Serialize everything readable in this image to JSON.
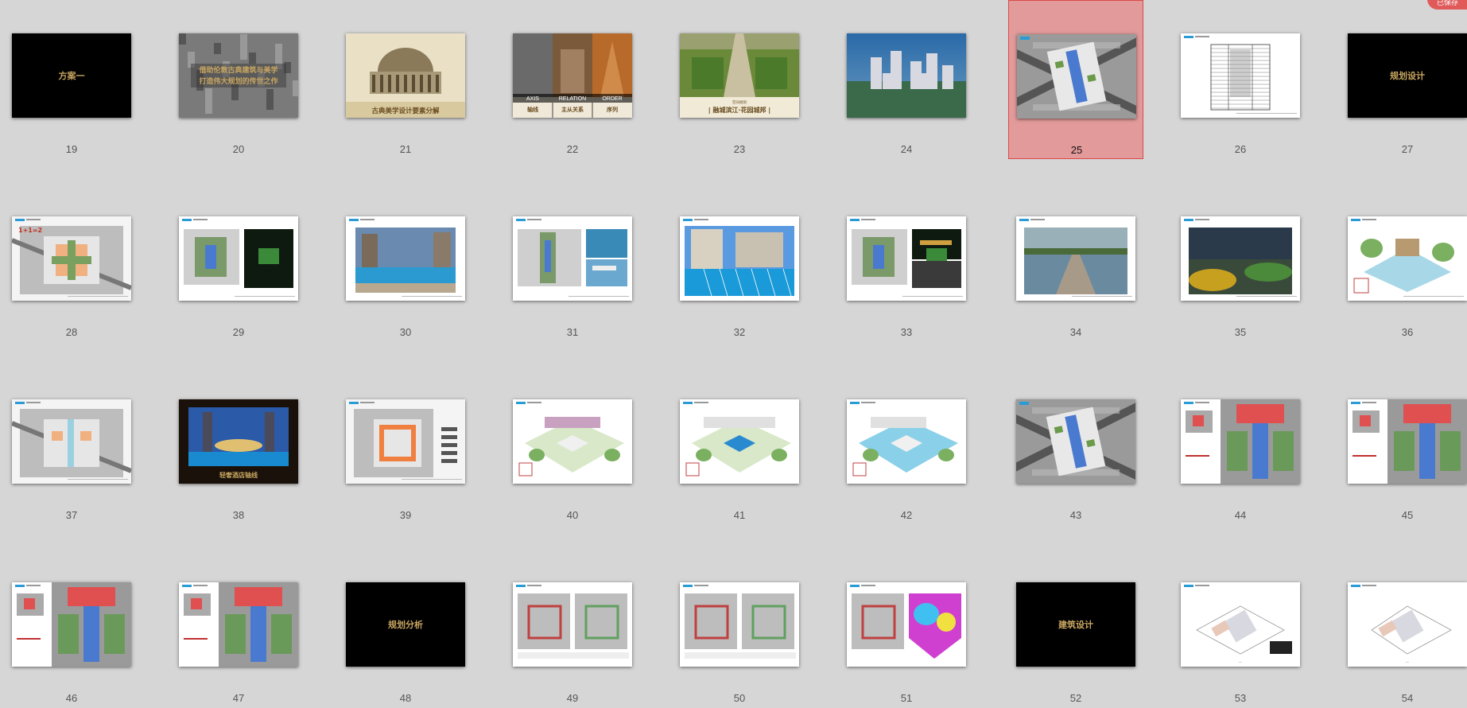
{
  "slides": [
    {
      "num": "19",
      "type": "title-dark",
      "text": "方案一"
    },
    {
      "num": "20",
      "type": "aerial-gray-title",
      "lines": [
        "借助伦敦古典建筑与美学",
        "打造伟大规划的传世之作"
      ]
    },
    {
      "num": "21",
      "type": "pantheon",
      "text": "古典美学设计要素分解"
    },
    {
      "num": "22",
      "type": "triptych",
      "labels_en": [
        "AXIS",
        "RELATION",
        "ORDER"
      ],
      "labels_cn": [
        "轴线",
        "主从关系",
        "序列"
      ]
    },
    {
      "num": "23",
      "type": "garden",
      "subtitle": "空间规划",
      "text": "| 融城滨江·花园城邦 |"
    },
    {
      "num": "24",
      "type": "rendering"
    },
    {
      "num": "25",
      "type": "siteplan",
      "selected": true
    },
    {
      "num": "26",
      "type": "table-doc"
    },
    {
      "num": "27",
      "type": "title-dark",
      "text": "规划设计"
    },
    {
      "num": "28",
      "type": "plan-diagram",
      "label": "1+1=2"
    },
    {
      "num": "29",
      "type": "plan-night"
    },
    {
      "num": "30",
      "type": "pool-photo"
    },
    {
      "num": "31",
      "type": "plan-pool"
    },
    {
      "num": "32",
      "type": "pool-photo-large"
    },
    {
      "num": "33",
      "type": "plan-night2"
    },
    {
      "num": "34",
      "type": "reflecting-pool"
    },
    {
      "num": "35",
      "type": "garden-photo"
    },
    {
      "num": "36",
      "type": "sketch-pavilion"
    },
    {
      "num": "37",
      "type": "plan-diagram2"
    },
    {
      "num": "38",
      "type": "night-pool",
      "text": "轻奢酒店轴线"
    },
    {
      "num": "39",
      "type": "plan-orange"
    },
    {
      "num": "40",
      "type": "sketch-axo"
    },
    {
      "num": "41",
      "type": "sketch-green"
    },
    {
      "num": "42",
      "type": "sketch-pool"
    },
    {
      "num": "43",
      "type": "siteplan"
    },
    {
      "num": "44",
      "type": "plan-red"
    },
    {
      "num": "45",
      "type": "plan-red-half"
    },
    {
      "num": "46",
      "type": "plan-red-left"
    },
    {
      "num": "47",
      "type": "plan-red-left2"
    },
    {
      "num": "48",
      "type": "title-dark",
      "text": "规划分析"
    },
    {
      "num": "49",
      "type": "analysis-two"
    },
    {
      "num": "50",
      "type": "analysis-two"
    },
    {
      "num": "51",
      "type": "analysis-heat"
    },
    {
      "num": "52",
      "type": "title-dark",
      "text": "建筑设计"
    },
    {
      "num": "53",
      "type": "arch-plan"
    },
    {
      "num": "54",
      "type": "arch-plan-half"
    }
  ],
  "colors": {
    "gold": "#c8a560",
    "selection": "#e39a9a",
    "badge": "#e05a5a"
  }
}
